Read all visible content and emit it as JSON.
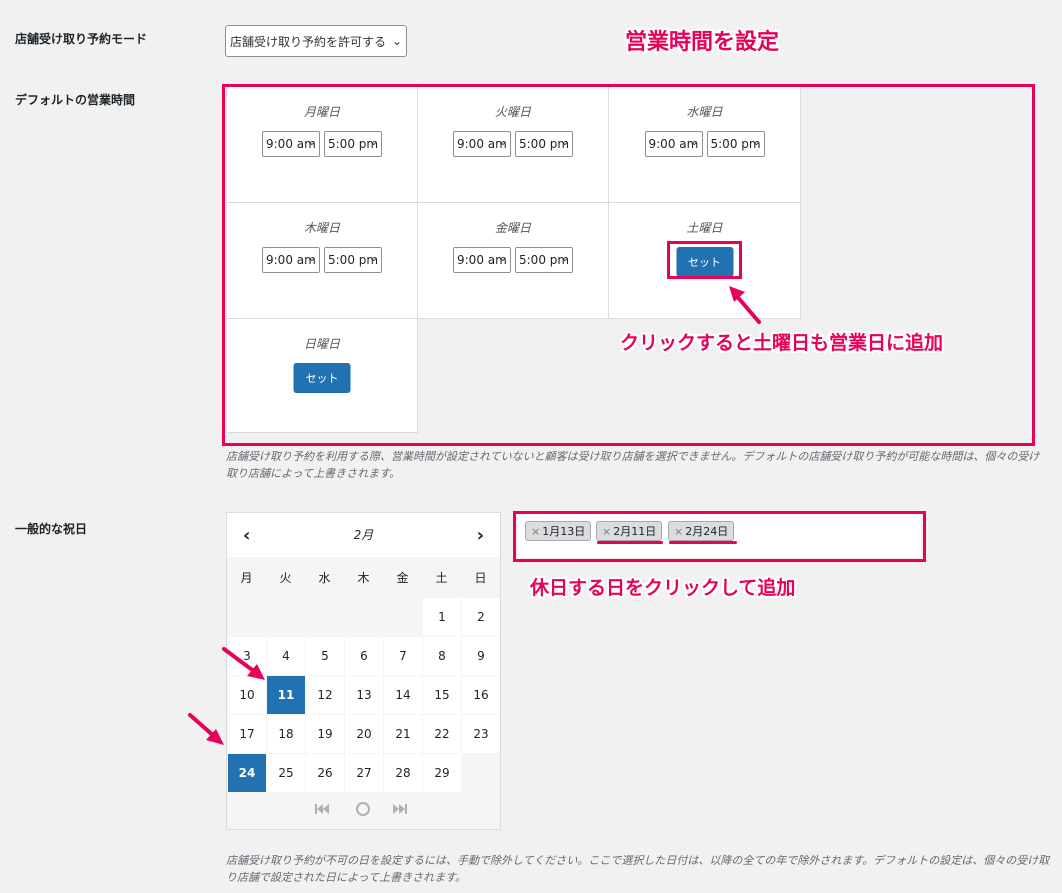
{
  "labels": {
    "pickup_mode": "店舗受け取り予約モード",
    "default_hours": "デフォルトの営業時間",
    "holidays": "一般的な祝日"
  },
  "pickup_select": {
    "value": "店舗受け取り予約を許可する"
  },
  "annotations": {
    "set_hours": "営業時間を設定",
    "saturday_hint": "クリックすると土曜日も営業日に追加",
    "holiday_hint": "休日する日をクリックして追加"
  },
  "week": {
    "days": [
      {
        "name": "月曜日",
        "open": "9:00 am",
        "close": "5:00 pm"
      },
      {
        "name": "火曜日",
        "open": "9:00 am",
        "close": "5:00 pm"
      },
      {
        "name": "水曜日",
        "open": "9:00 am",
        "close": "5:00 pm"
      },
      {
        "name": "木曜日",
        "open": "9:00 am",
        "close": "5:00 pm"
      },
      {
        "name": "金曜日",
        "open": "9:00 am",
        "close": "5:00 pm"
      },
      {
        "name": "土曜日",
        "button": "セット"
      },
      {
        "name": "日曜日",
        "button": "セット"
      }
    ]
  },
  "hours_description": "店舗受け取り予約を利用する際、営業時間が設定されていないと顧客は受け取り店舗を選択できません。デフォルトの店舗受け取り予約が可能な時間は、個々の受け取り店舗によって上書きされます。",
  "calendar": {
    "month": "2月",
    "prev": "‹",
    "next": "›",
    "weekdays": [
      "月",
      "火",
      "水",
      "木",
      "金",
      "土",
      "日"
    ],
    "weeks": [
      [
        "",
        "",
        "",
        "",
        "",
        "1",
        "2"
      ],
      [
        "3",
        "4",
        "5",
        "6",
        "7",
        "8",
        "9"
      ],
      [
        "10",
        "11",
        "12",
        "13",
        "14",
        "15",
        "16"
      ],
      [
        "17",
        "18",
        "19",
        "20",
        "21",
        "22",
        "23"
      ],
      [
        "24",
        "25",
        "26",
        "27",
        "28",
        "29",
        ""
      ]
    ],
    "selected": [
      "11",
      "24"
    ]
  },
  "holiday_tags": [
    {
      "label": "1月13日",
      "remove": "×"
    },
    {
      "label": "2月11日",
      "remove": "×"
    },
    {
      "label": "2月24日",
      "remove": "×"
    }
  ],
  "holidays_description": "店舗受け取り予約が不可の日を設定するには、手動で除外してください。ここで選択した日付は、以降の全ての年で除外されます。デフォルトの設定は、個々の受け取り店舗で設定された日によって上書きされます。",
  "colors": {
    "accent": "#2271b1",
    "annotation": "#e8005a"
  }
}
